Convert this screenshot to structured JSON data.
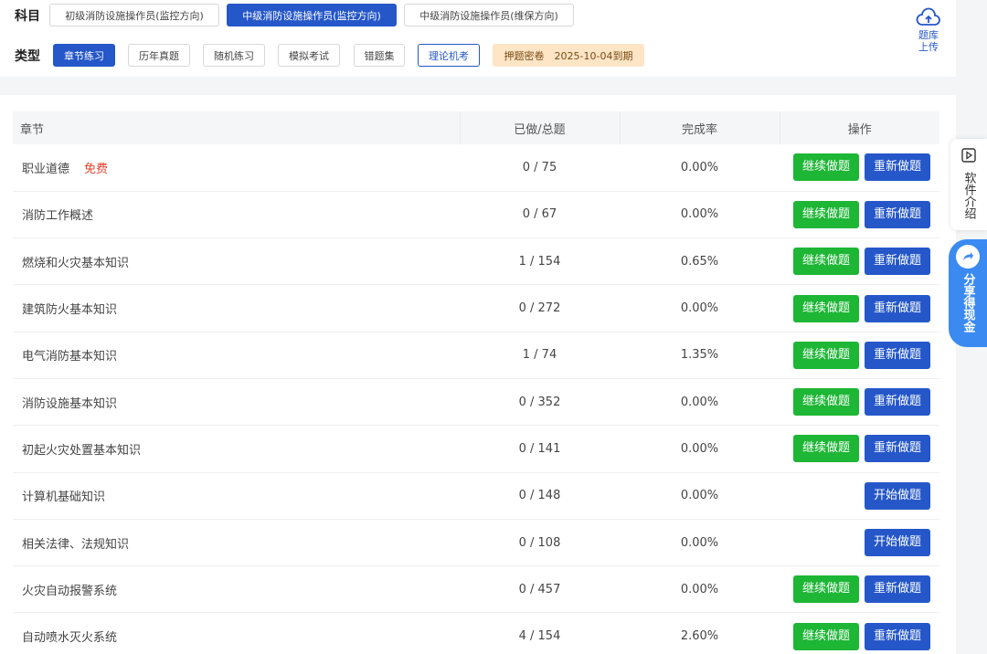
{
  "subject": {
    "label": "科目",
    "options": [
      "初级消防设施操作员(监控方向)",
      "中级消防设施操作员(监控方向)",
      "中级消防设施操作员(维保方向)"
    ],
    "selected": 1
  },
  "type_row": {
    "label": "类型",
    "options": [
      "章节练习",
      "历年真题",
      "随机练习",
      "模拟考试",
      "错题集",
      "理论机考"
    ],
    "promo": "押题密卷　2025-10-04到期"
  },
  "upload": {
    "label_line1": "题库",
    "label_line2": "上传",
    "icon": "cloud-upload-icon"
  },
  "table": {
    "headers": [
      "章节",
      "已做/总题",
      "完成率",
      "操作"
    ],
    "free_tag": "免费",
    "rows": [
      {
        "chapter": "职业道德",
        "progress": "0 / 75",
        "rate": "0.00%",
        "free": true,
        "continue": "继续做题",
        "action": "重新做题"
      },
      {
        "chapter": "消防工作概述",
        "progress": "0 / 67",
        "rate": "0.00%",
        "continue": "继续做题",
        "action": "重新做题"
      },
      {
        "chapter": "燃烧和火灾基本知识",
        "progress": "1 / 154",
        "rate": "0.65%",
        "continue": "继续做题",
        "action": "重新做题"
      },
      {
        "chapter": "建筑防火基本知识",
        "progress": "0 / 272",
        "rate": "0.00%",
        "continue": "继续做题",
        "action": "重新做题"
      },
      {
        "chapter": "电气消防基本知识",
        "progress": "1 / 74",
        "rate": "1.35%",
        "continue": "继续做题",
        "action": "重新做题"
      },
      {
        "chapter": "消防设施基本知识",
        "progress": "0 / 352",
        "rate": "0.00%",
        "continue": "继续做题",
        "action": "重新做题"
      },
      {
        "chapter": "初起火灾处置基本知识",
        "progress": "0 / 141",
        "rate": "0.00%",
        "continue": "继续做题",
        "action": "重新做题"
      },
      {
        "chapter": "计算机基础知识",
        "progress": "0 / 148",
        "rate": "0.00%",
        "action": "开始做题"
      },
      {
        "chapter": "相关法律、法规知识",
        "progress": "0 / 108",
        "rate": "0.00%",
        "action": "开始做题"
      },
      {
        "chapter": "火灾自动报警系统",
        "progress": "0 / 457",
        "rate": "0.00%",
        "continue": "继续做题",
        "action": "重新做题"
      },
      {
        "chapter": "自动喷水灭火系统",
        "progress": "4 / 154",
        "rate": "2.60%",
        "continue": "继续做题",
        "action": "重新做题"
      }
    ]
  },
  "side": {
    "intro": "软件介绍",
    "share": "分享得现金"
  },
  "colors": {
    "primary": "#2557c9",
    "green": "#1db635",
    "free": "#e8412e",
    "share": "#3b8af2"
  }
}
